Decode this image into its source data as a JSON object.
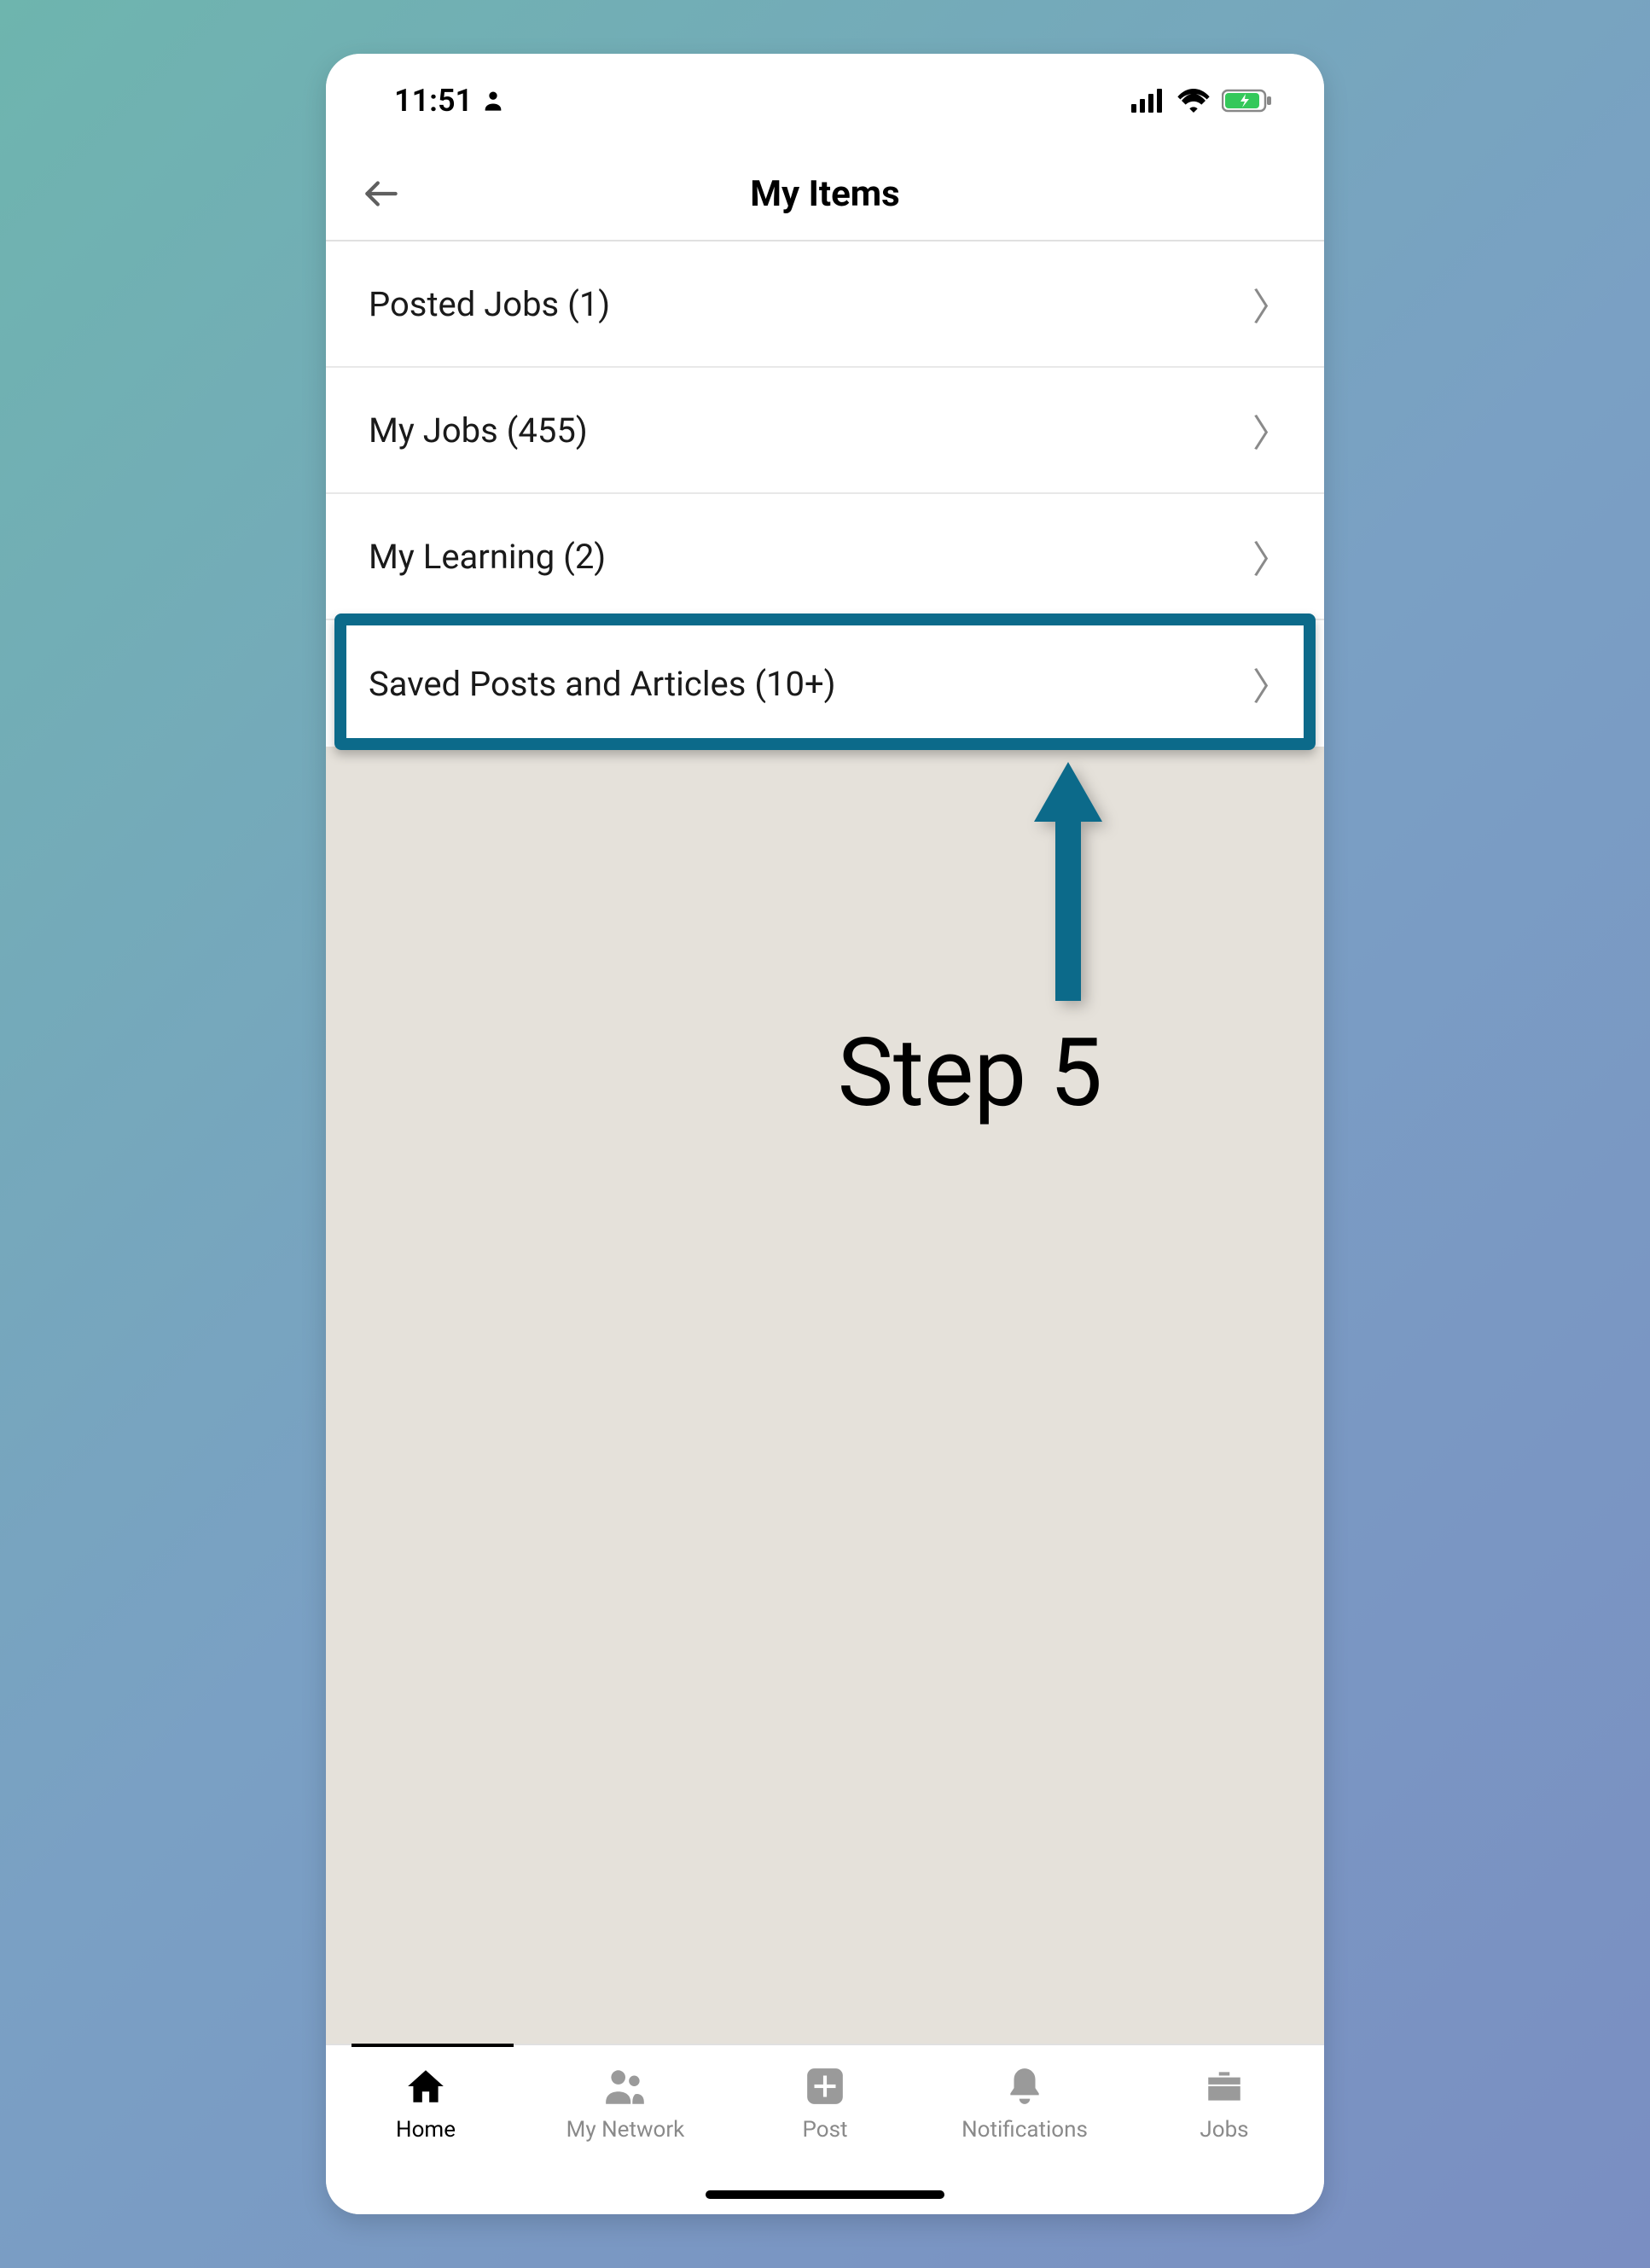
{
  "statusBar": {
    "time": "11:51"
  },
  "header": {
    "title": "My Items"
  },
  "list": {
    "items": [
      {
        "label": "Posted Jobs (1)"
      },
      {
        "label": "My Jobs (455)"
      },
      {
        "label": "My Learning (2)"
      },
      {
        "label": "Saved Posts and Articles (10+)"
      }
    ]
  },
  "annotation": {
    "step_label": "Step 5"
  },
  "tabs": {
    "items": [
      {
        "label": "Home"
      },
      {
        "label": "My Network"
      },
      {
        "label": "Post"
      },
      {
        "label": "Notifications"
      },
      {
        "label": "Jobs"
      }
    ]
  }
}
